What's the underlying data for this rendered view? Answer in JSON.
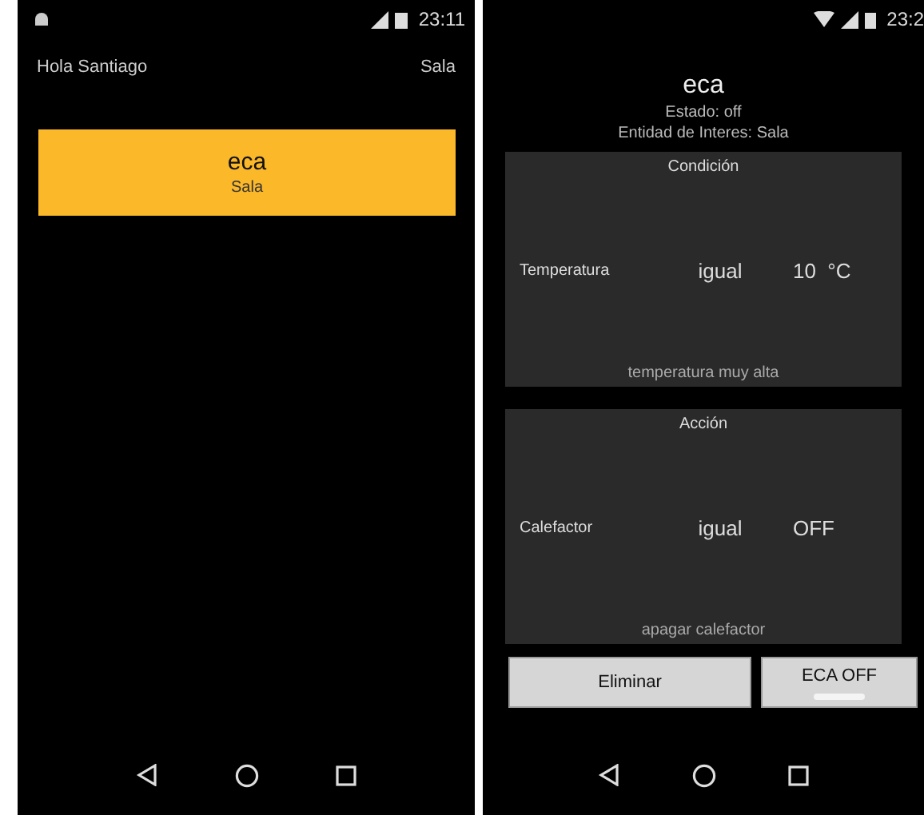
{
  "left_screen": {
    "status_bar": {
      "time": "23:11"
    },
    "header": {
      "greeting": "Hola Santiago",
      "room": "Sala"
    },
    "cards": [
      {
        "title": "eca",
        "subtitle": "Sala"
      }
    ]
  },
  "right_screen": {
    "status_bar": {
      "time": "23:2"
    },
    "title": "eca",
    "state": "Estado: off",
    "entity": "Entidad de Interes: Sala",
    "panels": [
      {
        "title": "Condición",
        "variable": "Temperatura",
        "operator": "igual",
        "value": "10  °C",
        "description": "temperatura muy alta"
      },
      {
        "title": "Acción",
        "variable": "Calefactor",
        "operator": "igual",
        "value": "OFF",
        "description": "apagar calefactor"
      }
    ],
    "delete_button": "Eliminar",
    "toggle": {
      "label": "ECA OFF",
      "on": false
    }
  }
}
